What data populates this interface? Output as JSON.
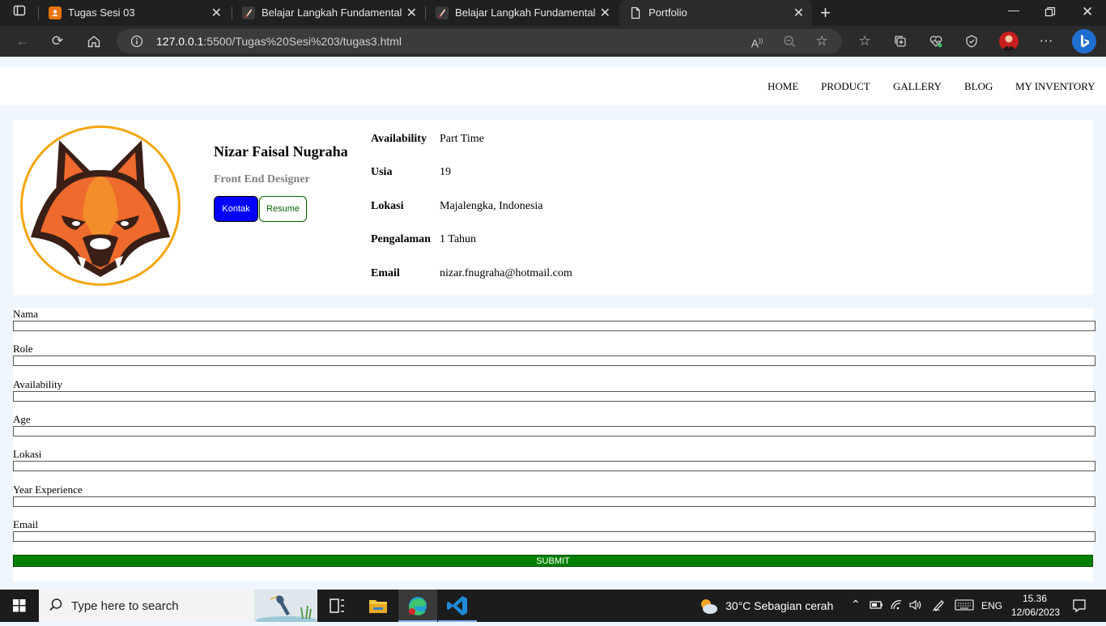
{
  "browser": {
    "tabs": [
      {
        "title": "Tugas Sesi 03",
        "active": false
      },
      {
        "title": "Belajar Langkah Fundamental Un",
        "active": false
      },
      {
        "title": "Belajar Langkah Fundamental Un",
        "active": false
      },
      {
        "title": "Portfolio",
        "active": true
      }
    ],
    "url_host": "127.0.0.1",
    "url_rest": ":5500/Tugas%20Sesi%203/tugas3.html"
  },
  "nav": {
    "items": [
      "HOME",
      "PRODUCT",
      "GALLERY",
      "BLOG",
      "MY INVENTORY"
    ]
  },
  "profile": {
    "name": "Nizar Faisal Nugraha",
    "role": "Front End Designer",
    "kontak_label": "Kontak",
    "resume_label": "Resume",
    "info": [
      {
        "label": "Availability",
        "value": "Part Time"
      },
      {
        "label": "Usia",
        "value": "19"
      },
      {
        "label": "Lokasi",
        "value": "Majalengka, Indonesia"
      },
      {
        "label": "Pengalaman",
        "value": "1 Tahun"
      },
      {
        "label": "Email",
        "value": "nizar.fnugraha@hotmail.com"
      }
    ]
  },
  "form": {
    "fields": [
      "Nama",
      "Role",
      "Availability",
      "Age",
      "Lokasi",
      "Year Experience",
      "Email"
    ],
    "submit_label": "SUBMIT"
  },
  "taskbar": {
    "search_placeholder": "Type here to search",
    "weather": "30°C  Sebagian cerah",
    "lang": "ENG",
    "time": "15.36",
    "date": "12/06/2023"
  }
}
